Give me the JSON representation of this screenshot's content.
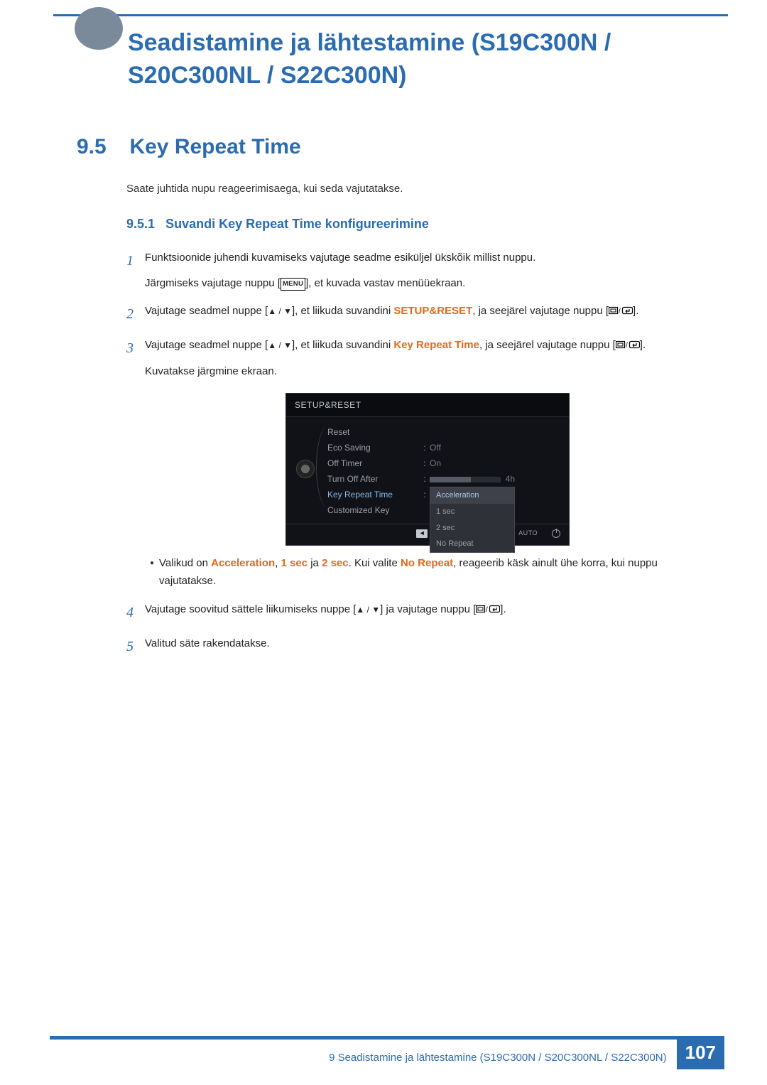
{
  "chapter": {
    "title": "Seadistamine ja lähtestamine (S19C300N / S20C300NL / S22C300N)"
  },
  "section": {
    "num": "9.5",
    "title": "Key Repeat Time",
    "intro": "Saate juhtida nupu reageerimisaega, kui seda vajutatakse."
  },
  "subsection": {
    "num": "9.5.1",
    "title": "Suvandi Key Repeat Time konfigureerimine"
  },
  "steps": {
    "s1": {
      "num": "1",
      "p1": "Funktsioonide juhendi kuvamiseks vajutage seadme esiküljel ükskõik millist nuppu.",
      "p2a": "Järgmiseks vajutage nuppu [",
      "menu": "MENU",
      "p2b": "], et kuvada vastav menüüekraan."
    },
    "s2": {
      "num": "2",
      "a": "Vajutage seadmel nuppe [",
      "b": "], et liikuda suvandini ",
      "hl": "SETUP&RESET",
      "c": ", ja seejärel vajutage nuppu [",
      "d": "]."
    },
    "s3": {
      "num": "3",
      "a": "Vajutage seadmel nuppe [",
      "b": "], et liikuda suvandini ",
      "hl": "Key Repeat Time",
      "c": ", ja seejärel vajutage nuppu [",
      "d": "].",
      "after": "Kuvatakse järgmine ekraan."
    },
    "bullet": {
      "a": "Valikud on ",
      "h1": "Acceleration",
      "b": ", ",
      "h2": "1 sec",
      "c": " ja ",
      "h3": "2 sec",
      "d": ". Kui valite ",
      "h4": "No Repeat",
      "e": ", reageerib käsk ainult ühe korra, kui nuppu vajutatakse."
    },
    "s4": {
      "num": "4",
      "a": "Vajutage soovitud sättele liikumiseks nuppe [",
      "b": "] ja vajutage nuppu [",
      "c": "]."
    },
    "s5": {
      "num": "5",
      "a": "Valitud säte rakendatakse."
    }
  },
  "osd": {
    "header": "SETUP&RESET",
    "rows": {
      "reset": "Reset",
      "eco": "Eco Saving",
      "eco_v": "Off",
      "off_timer": "Off Timer",
      "off_timer_v": "On",
      "turn_off": "Turn Off After",
      "turn_off_v": "4h",
      "krt": "Key Repeat Time",
      "ck": "Customized Key"
    },
    "dropdown": {
      "o1": "Acceleration",
      "o2": "1 sec",
      "o3": "2 sec",
      "o4": "No Repeat"
    },
    "nav": {
      "auto": "AUTO"
    }
  },
  "footer": {
    "text": "9 Seadistamine ja lähtestamine (S19C300N / S20C300NL / S22C300N)",
    "page": "107"
  }
}
